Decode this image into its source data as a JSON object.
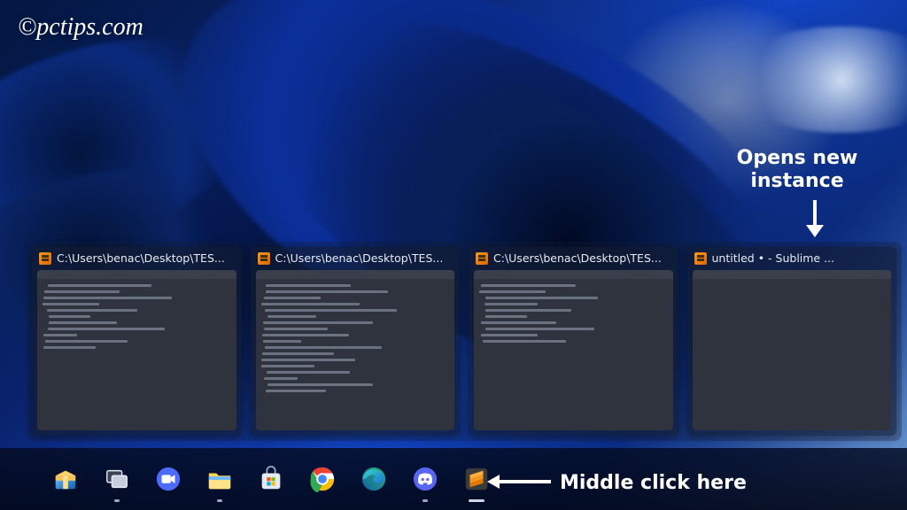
{
  "watermark": "©pctips.com",
  "annotations": {
    "opens_new_instance": "Opens new instance",
    "middle_click_here": "Middle click here"
  },
  "previews": [
    {
      "title": "C:\\Users\\benac\\Desktop\\TES...",
      "code_widths": [
        55,
        40,
        68,
        30,
        48,
        22,
        36,
        62,
        18,
        44,
        28
      ]
    },
    {
      "title": "C:\\Users\\benac\\Desktop\\TES...",
      "code_widths": [
        45,
        65,
        30,
        52,
        70,
        26,
        58,
        34,
        46,
        20,
        62,
        38,
        50,
        28,
        44,
        18,
        56,
        32
      ]
    },
    {
      "title": "C:\\Users\\benac\\Desktop\\TES...",
      "code_widths": [
        50,
        35,
        60,
        28,
        46,
        22,
        40,
        58,
        30,
        44
      ]
    },
    {
      "title": "untitled • - Sublime ...",
      "code_widths": []
    }
  ],
  "taskbar_icons": [
    "package-icon",
    "task-view-icon",
    "meet-icon",
    "file-explorer-icon",
    "microsoft-store-icon",
    "chrome-icon",
    "edge-icon",
    "discord-icon",
    "sublime-text-icon"
  ]
}
